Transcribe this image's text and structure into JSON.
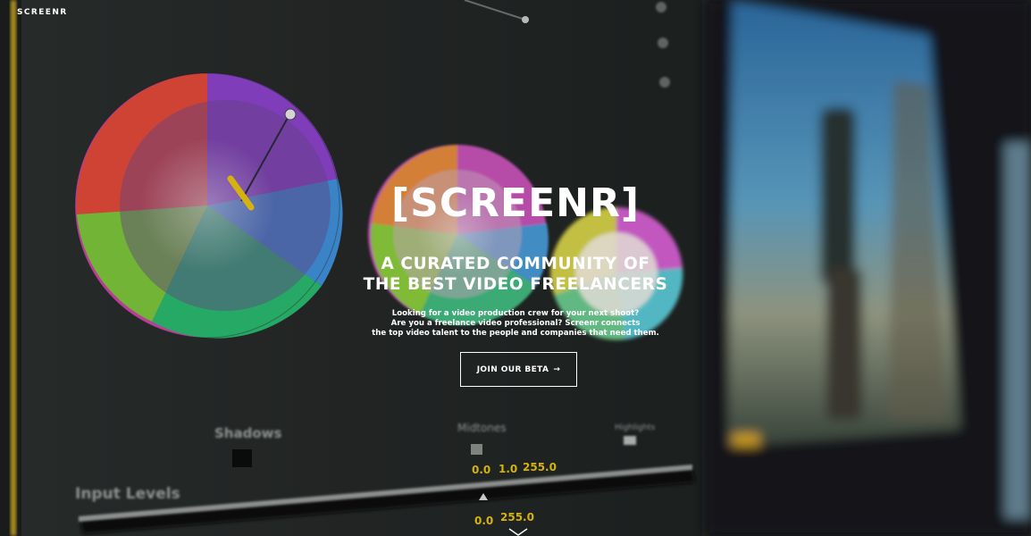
{
  "header": {
    "brand": "SCREENR"
  },
  "hero": {
    "logo": "[SCREENR]",
    "headline_line1": "A CURATED COMMUNITY OF",
    "headline_line2": "THE BEST VIDEO FREELANCERS",
    "sub_line1": "Looking for a video production crew for your next shoot?",
    "sub_line2": "Are you a freelance video professional? Screenr connects",
    "sub_line3": "the top video talent to the people and companies that need them.",
    "cta_label": "JOIN OUR BETA",
    "cta_arrow": "→"
  },
  "background": {
    "labels": {
      "shadows": "Shadows",
      "midtones": "Midtones",
      "highlights": "Highlights",
      "input_levels": "Input Levels",
      "val_a": "0.0",
      "val_b": "1.0",
      "val_c": "255.0",
      "val_d": "0.0",
      "val_e": "255.0"
    }
  },
  "icons": {
    "scroll": "chevron-down-icon"
  },
  "colors": {
    "text": "#ffffff",
    "backdrop": "#1b1d1c",
    "accent_yellow": "#e8c20f"
  }
}
